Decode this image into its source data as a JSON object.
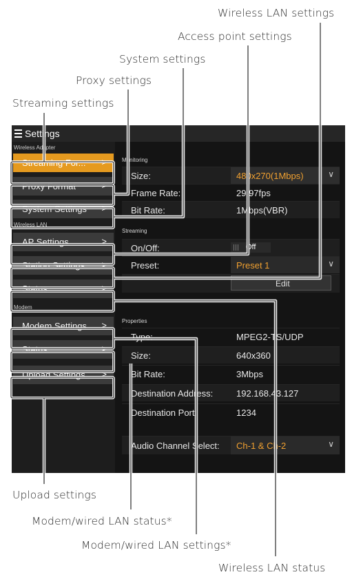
{
  "callouts": {
    "wireless_lan_settings": "Wireless LAN settings",
    "access_point_settings": "Access point settings",
    "system_settings": "System settings",
    "proxy_settings": "Proxy settings",
    "streaming_settings": "Streaming settings",
    "upload_settings": "Upload settings",
    "modem_wired_status": "Modem/wired LAN status*",
    "modem_wired_settings": "Modem/wired LAN settings*",
    "wireless_lan_status": "Wireless LAN status"
  },
  "header": {
    "title": "Settings",
    "menu_icon": "hamburger-menu-icon"
  },
  "sidebar": {
    "groups": [
      {
        "label": "Wireless Adapter",
        "items": [
          {
            "label": "Streaming For..."
          },
          {
            "label": "Proxy Format"
          },
          {
            "label": "System Settings"
          }
        ]
      },
      {
        "label": "Wireless LAN",
        "items": [
          {
            "label": "AP Settings"
          },
          {
            "label": "Station Settings"
          },
          {
            "label": "Status"
          }
        ]
      },
      {
        "label": "Modem",
        "items": [
          {
            "label": "Modem Settings"
          },
          {
            "label": "Status"
          },
          {
            "label": "Upload Settings"
          }
        ]
      }
    ],
    "chevron": ">"
  },
  "monitoring": {
    "label": "Monitoring",
    "size_label": "Size:",
    "size_value": "480x270(1Mbps)",
    "frame_rate_label": "Frame Rate:",
    "frame_rate_value": "29.97fps",
    "bit_rate_label": "Bit Rate:",
    "bit_rate_value": "1Mbps(VBR)"
  },
  "streaming": {
    "label": "Streaming",
    "onoff_label": "On/Off:",
    "onoff_value": "Off",
    "preset_label": "Preset:",
    "preset_value": "Preset 1",
    "edit_label": "Edit"
  },
  "properties": {
    "label": "Properties",
    "type_label": "Type:",
    "type_value": "MPEG2-TS/UDP",
    "size_label": "Size:",
    "size_value": "640x360",
    "bit_rate_label": "Bit Rate:",
    "bit_rate_value": "3Mbps",
    "dest_addr_label": "Destination Address:",
    "dest_addr_value": "192.168.43.127",
    "dest_port_label": "Destination Port:",
    "dest_port_value": "1234",
    "audio_label": "Audio Channel Select:",
    "audio_value": "Ch-1 & Ch-2"
  },
  "colors": {
    "accent": "#e59a1f",
    "value_orange": "#f0a030",
    "background": "#141414",
    "button": "#3b3b3b"
  }
}
